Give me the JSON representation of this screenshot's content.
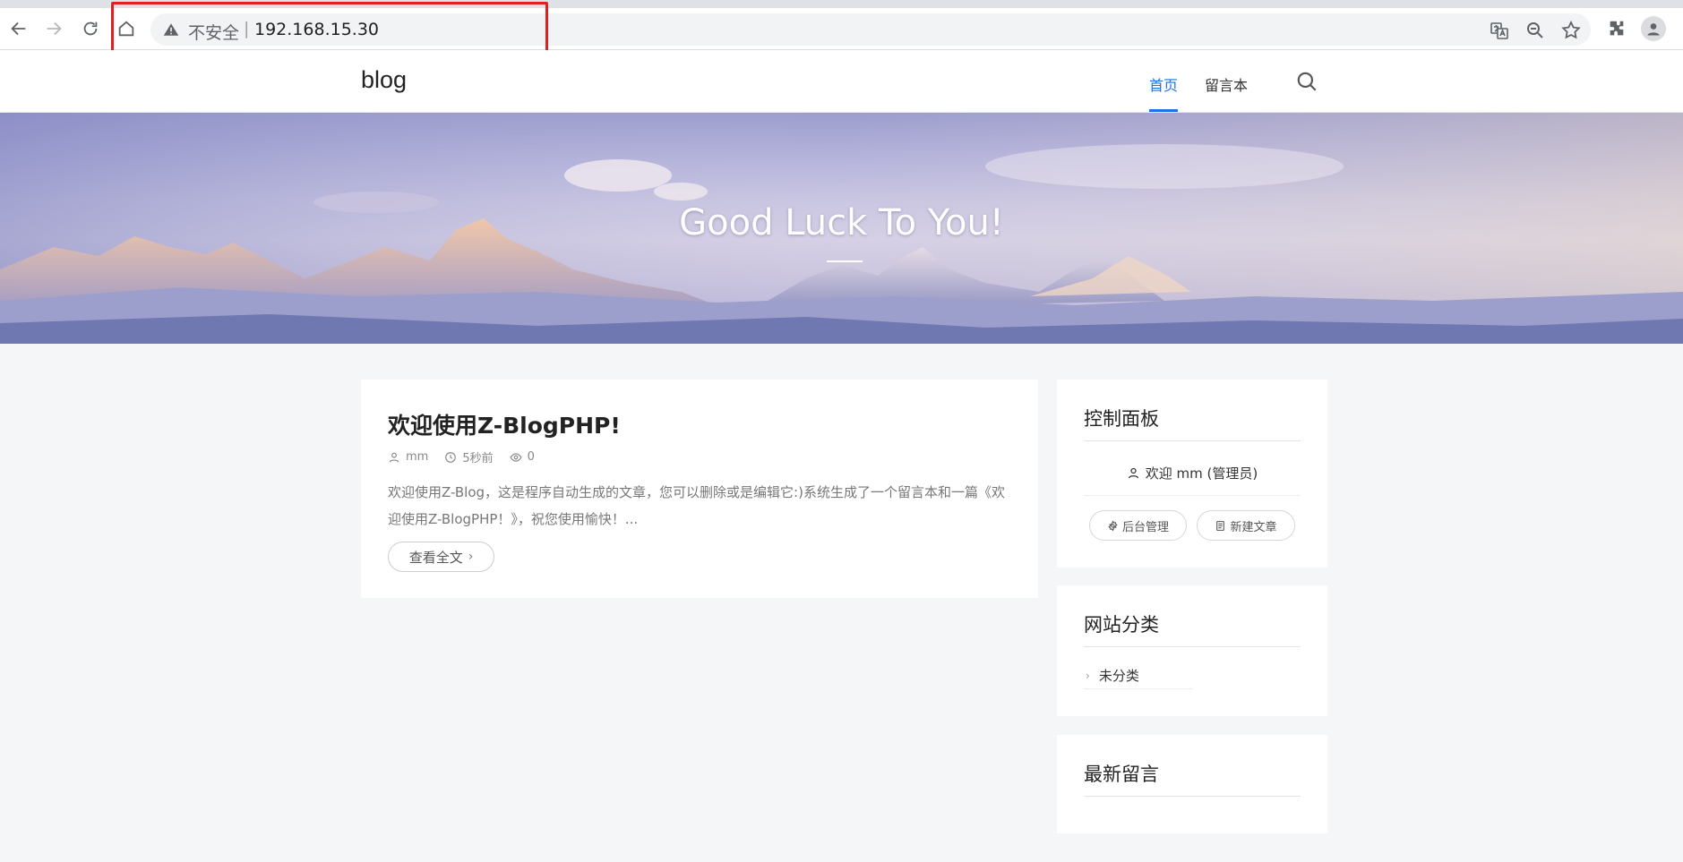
{
  "browser": {
    "security_label": "不安全",
    "separator": "|",
    "url": "192.168.15.30"
  },
  "site": {
    "logo": "blog",
    "nav": [
      {
        "label": "首页",
        "active": true
      },
      {
        "label": "留言本",
        "active": false
      }
    ]
  },
  "banner": {
    "title": "Good Luck To You!"
  },
  "post": {
    "title": "欢迎使用Z-BlogPHP!",
    "author": "mm",
    "time": "5秒前",
    "views": "0",
    "excerpt": "欢迎使用Z-Blog，这是程序自动生成的文章，您可以删除或是编辑它:)系统生成了一个留言本和一篇《欢迎使用Z-BlogPHP！》，祝您使用愉快！...",
    "read_more": "查看全文"
  },
  "sidebar": {
    "control_panel": {
      "title": "控制面板",
      "welcome": "欢迎 mm (管理员)",
      "admin_button": "后台管理",
      "new_post_button": "新建文章"
    },
    "categories": {
      "title": "网站分类",
      "items": [
        "未分类"
      ]
    },
    "comments": {
      "title": "最新留言"
    }
  },
  "colors": {
    "accent": "#1a73e8",
    "annotation_box": "#e02020"
  }
}
